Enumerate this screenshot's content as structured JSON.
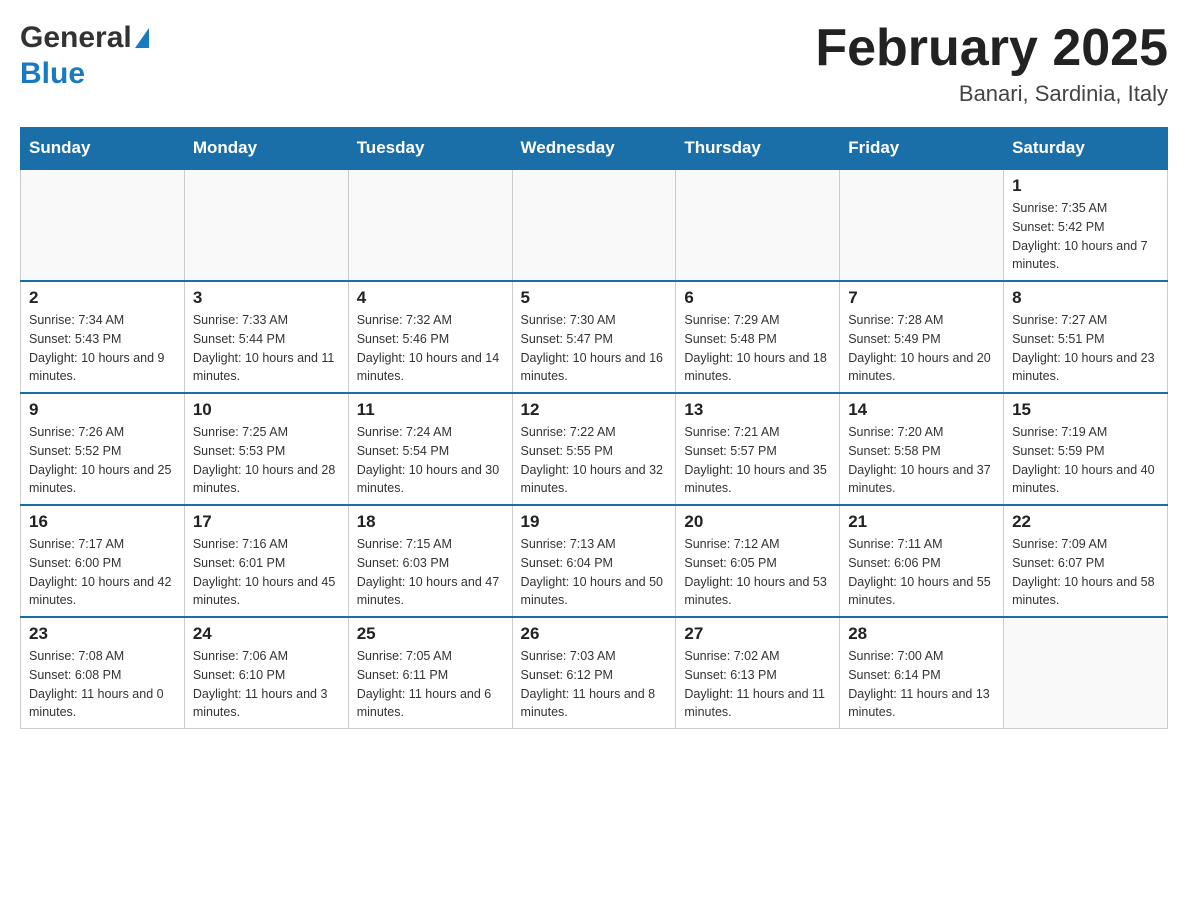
{
  "header": {
    "logo_general": "General",
    "logo_blue": "Blue",
    "month_title": "February 2025",
    "location": "Banari, Sardinia, Italy"
  },
  "weekdays": [
    "Sunday",
    "Monday",
    "Tuesday",
    "Wednesday",
    "Thursday",
    "Friday",
    "Saturday"
  ],
  "weeks": [
    [
      {
        "day": "",
        "info": ""
      },
      {
        "day": "",
        "info": ""
      },
      {
        "day": "",
        "info": ""
      },
      {
        "day": "",
        "info": ""
      },
      {
        "day": "",
        "info": ""
      },
      {
        "day": "",
        "info": ""
      },
      {
        "day": "1",
        "info": "Sunrise: 7:35 AM\nSunset: 5:42 PM\nDaylight: 10 hours and 7 minutes."
      }
    ],
    [
      {
        "day": "2",
        "info": "Sunrise: 7:34 AM\nSunset: 5:43 PM\nDaylight: 10 hours and 9 minutes."
      },
      {
        "day": "3",
        "info": "Sunrise: 7:33 AM\nSunset: 5:44 PM\nDaylight: 10 hours and 11 minutes."
      },
      {
        "day": "4",
        "info": "Sunrise: 7:32 AM\nSunset: 5:46 PM\nDaylight: 10 hours and 14 minutes."
      },
      {
        "day": "5",
        "info": "Sunrise: 7:30 AM\nSunset: 5:47 PM\nDaylight: 10 hours and 16 minutes."
      },
      {
        "day": "6",
        "info": "Sunrise: 7:29 AM\nSunset: 5:48 PM\nDaylight: 10 hours and 18 minutes."
      },
      {
        "day": "7",
        "info": "Sunrise: 7:28 AM\nSunset: 5:49 PM\nDaylight: 10 hours and 20 minutes."
      },
      {
        "day": "8",
        "info": "Sunrise: 7:27 AM\nSunset: 5:51 PM\nDaylight: 10 hours and 23 minutes."
      }
    ],
    [
      {
        "day": "9",
        "info": "Sunrise: 7:26 AM\nSunset: 5:52 PM\nDaylight: 10 hours and 25 minutes."
      },
      {
        "day": "10",
        "info": "Sunrise: 7:25 AM\nSunset: 5:53 PM\nDaylight: 10 hours and 28 minutes."
      },
      {
        "day": "11",
        "info": "Sunrise: 7:24 AM\nSunset: 5:54 PM\nDaylight: 10 hours and 30 minutes."
      },
      {
        "day": "12",
        "info": "Sunrise: 7:22 AM\nSunset: 5:55 PM\nDaylight: 10 hours and 32 minutes."
      },
      {
        "day": "13",
        "info": "Sunrise: 7:21 AM\nSunset: 5:57 PM\nDaylight: 10 hours and 35 minutes."
      },
      {
        "day": "14",
        "info": "Sunrise: 7:20 AM\nSunset: 5:58 PM\nDaylight: 10 hours and 37 minutes."
      },
      {
        "day": "15",
        "info": "Sunrise: 7:19 AM\nSunset: 5:59 PM\nDaylight: 10 hours and 40 minutes."
      }
    ],
    [
      {
        "day": "16",
        "info": "Sunrise: 7:17 AM\nSunset: 6:00 PM\nDaylight: 10 hours and 42 minutes."
      },
      {
        "day": "17",
        "info": "Sunrise: 7:16 AM\nSunset: 6:01 PM\nDaylight: 10 hours and 45 minutes."
      },
      {
        "day": "18",
        "info": "Sunrise: 7:15 AM\nSunset: 6:03 PM\nDaylight: 10 hours and 47 minutes."
      },
      {
        "day": "19",
        "info": "Sunrise: 7:13 AM\nSunset: 6:04 PM\nDaylight: 10 hours and 50 minutes."
      },
      {
        "day": "20",
        "info": "Sunrise: 7:12 AM\nSunset: 6:05 PM\nDaylight: 10 hours and 53 minutes."
      },
      {
        "day": "21",
        "info": "Sunrise: 7:11 AM\nSunset: 6:06 PM\nDaylight: 10 hours and 55 minutes."
      },
      {
        "day": "22",
        "info": "Sunrise: 7:09 AM\nSunset: 6:07 PM\nDaylight: 10 hours and 58 minutes."
      }
    ],
    [
      {
        "day": "23",
        "info": "Sunrise: 7:08 AM\nSunset: 6:08 PM\nDaylight: 11 hours and 0 minutes."
      },
      {
        "day": "24",
        "info": "Sunrise: 7:06 AM\nSunset: 6:10 PM\nDaylight: 11 hours and 3 minutes."
      },
      {
        "day": "25",
        "info": "Sunrise: 7:05 AM\nSunset: 6:11 PM\nDaylight: 11 hours and 6 minutes."
      },
      {
        "day": "26",
        "info": "Sunrise: 7:03 AM\nSunset: 6:12 PM\nDaylight: 11 hours and 8 minutes."
      },
      {
        "day": "27",
        "info": "Sunrise: 7:02 AM\nSunset: 6:13 PM\nDaylight: 11 hours and 11 minutes."
      },
      {
        "day": "28",
        "info": "Sunrise: 7:00 AM\nSunset: 6:14 PM\nDaylight: 11 hours and 13 minutes."
      },
      {
        "day": "",
        "info": ""
      }
    ]
  ]
}
